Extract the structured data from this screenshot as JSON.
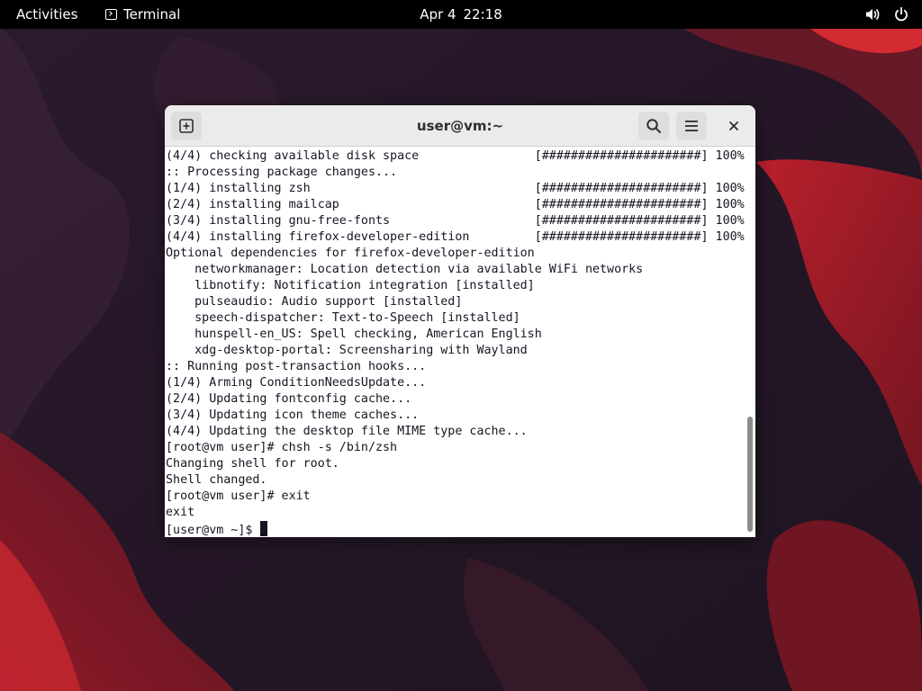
{
  "topbar": {
    "activities": "Activities",
    "app_name": "Terminal",
    "app_icon": "terminal-icon",
    "date": "Apr 4",
    "time": "22:18",
    "tray_icons": [
      "volume-icon",
      "power-icon"
    ]
  },
  "window": {
    "title": "user@vm:~",
    "buttons": [
      "new-tab-icon",
      "search-icon",
      "hamburger-menu-icon",
      "close-icon"
    ]
  },
  "terminal": {
    "lines": [
      "(4/4) checking available disk space                [######################] 100%",
      ":: Processing package changes...",
      "(1/4) installing zsh                               [######################] 100%",
      "(2/4) installing mailcap                           [######################] 100%",
      "(3/4) installing gnu-free-fonts                    [######################] 100%",
      "(4/4) installing firefox-developer-edition         [######################] 100%",
      "Optional dependencies for firefox-developer-edition",
      "    networkmanager: Location detection via available WiFi networks",
      "    libnotify: Notification integration [installed]",
      "    pulseaudio: Audio support [installed]",
      "    speech-dispatcher: Text-to-Speech [installed]",
      "    hunspell-en_US: Spell checking, American English",
      "    xdg-desktop-portal: Screensharing with Wayland",
      ":: Running post-transaction hooks...",
      "(1/4) Arming ConditionNeedsUpdate...",
      "(2/4) Updating fontconfig cache...",
      "(3/4) Updating icon theme caches...",
      "(4/4) Updating the desktop file MIME type cache...",
      "[root@vm user]# chsh -s /bin/zsh",
      "Changing shell for root.",
      "Shell changed.",
      "[root@vm user]# exit",
      "exit"
    ],
    "prompt": "[user@vm ~]$ "
  },
  "colors": {
    "topbar_bg": "#000000",
    "headerbar_bg": "#ebebeb",
    "terminal_bg": "#ffffff",
    "terminal_fg": "#171421",
    "wallpaper_dark": "#1c1222",
    "wallpaper_red": "#b0202a"
  }
}
